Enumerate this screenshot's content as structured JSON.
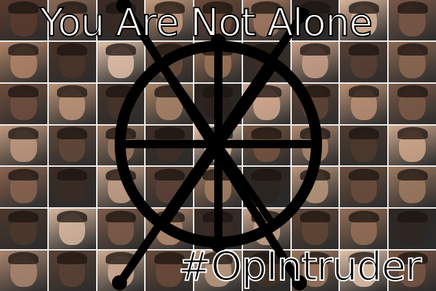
{
  "poster": {
    "headline": "You Are Not Alone",
    "hashtag": "#OpIntruder"
  },
  "collage": {
    "tile_colors": [
      "#5a3b2e",
      "#8a6a58",
      "#3a2a22",
      "#c49a7c",
      "#6e4a3a",
      "#a07860",
      "#2e2420",
      "#d8b49a",
      "#7a5848",
      "#b08468",
      "#4a3428",
      "#e0c0a8",
      "#6a4c3c",
      "#9c7458",
      "#3c2c24",
      "#c8a088",
      "#584034",
      "#8c6850",
      "#704e3e",
      "#bc9478",
      "#46342a",
      "#a88468",
      "#2a201c",
      "#d4aa90",
      "#5e4436",
      "#b89074",
      "#7c5a48",
      "#c09a80",
      "#62483a",
      "#9a7860",
      "#3e2e26",
      "#e4c4ac",
      "#74543f",
      "#ac8870",
      "#4e3a2e",
      "#d0a88c",
      "#8a6450",
      "#3a2c24",
      "#c4a08a",
      "#5c4236",
      "#a47e64",
      "#2c2420",
      "#b8967c",
      "#6c4e3e",
      "#9e7a60",
      "#4c382c",
      "#d8b8a0",
      "#7e5c4a",
      "#b48c72",
      "#3a2a22",
      "#c8a48c",
      "#604636",
      "#946e56",
      "#2e2622",
      "#aa8670",
      "#5a4234",
      "#d0ac92",
      "#6a4a3a",
      "#bc9a80",
      "#423228",
      "#9a765e",
      "#e2c2aa",
      "#785644"
    ]
  },
  "emblem": {
    "stroke_color": "#000000",
    "node_color": "#000000"
  }
}
